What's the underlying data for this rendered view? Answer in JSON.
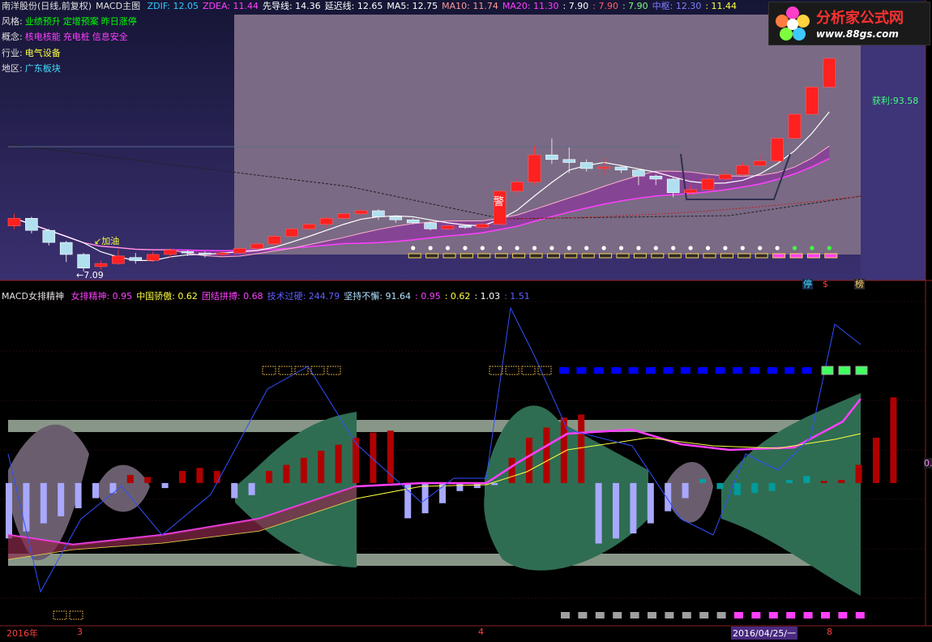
{
  "header": {
    "stock_title": "南洋股份(日线,前复权)",
    "main_chart": "MACD主图",
    "indicators": [
      {
        "label": "ZDIF: 12.05",
        "color": "#35c8ff"
      },
      {
        "label": "ZDEA: 11.44",
        "color": "#ff40ff"
      },
      {
        "label": "先导线: 14.36",
        "color": "#ffffff"
      },
      {
        "label": "延迟线: 12.65",
        "color": "#ffffff"
      },
      {
        "label": "MA5: 12.75",
        "color": "#ffffff"
      },
      {
        "label": "MA10: 11.74",
        "color": "#ff9a9a"
      },
      {
        "label": "MA20: 11.30",
        "color": "#ff40ff"
      },
      {
        "label": ": 7.90",
        "color": "#ffffff"
      },
      {
        "label": ": 7.90",
        "color": "#ff6060"
      },
      {
        "label": ": 7.90",
        "color": "#7dff7d"
      },
      {
        "label": "中枢: 12.30",
        "color": "#8080ff"
      },
      {
        "label": ": 11.44",
        "color": "#ffff40"
      }
    ]
  },
  "stock_info": [
    {
      "label": "风格:",
      "values": [
        "业绩预升",
        "定增预案",
        "昨日涨停"
      ],
      "color": "#00ff00"
    },
    {
      "label": "概念:",
      "values": [
        "核电核能",
        "充电桩",
        "信息安全"
      ],
      "color": "#ff40ff"
    },
    {
      "label": "行业:",
      "values": [
        "电气设备"
      ],
      "color": "#ffff40"
    },
    {
      "label": "地区:",
      "values": [
        "广东板块"
      ],
      "color": "#40e0ff"
    }
  ],
  "main_annotations": {
    "profit": "获利:93.58",
    "low_price": "←7.09",
    "add_oil": "↙加油",
    "alarm": "警"
  },
  "logo": {
    "name": "分析家公式网",
    "url": "www.88gs.com"
  },
  "side_buttons": [
    {
      "label": "停",
      "color": "#40e0ff"
    },
    {
      "label": "$",
      "color": "#ff4040"
    },
    {
      "label": "榜",
      "color": "#ffcc66"
    }
  ],
  "sub_header": {
    "name": "MACD女排精神",
    "indicators": [
      {
        "label": "女排精神: 0.95",
        "color": "#ff40ff"
      },
      {
        "label": "中国骄傲: 0.62",
        "color": "#ffff40"
      },
      {
        "label": "团结拼搏: 0.68",
        "color": "#ff40ff"
      },
      {
        "label": "技术过硬: 244.79",
        "color": "#6060ff"
      },
      {
        "label": "坚持不懈: 91.64",
        "color": "#b0e0ff"
      },
      {
        "label": ": 0.95",
        "color": "#ff40ff"
      },
      {
        "label": ": 0.62",
        "color": "#ffff40"
      },
      {
        "label": ": 1.03",
        "color": "#ffffff"
      },
      {
        "label": ": 1.51",
        "color": "#6060ff"
      }
    ]
  },
  "sub_value_tag": "0.",
  "x_axis": {
    "labels": [
      "2016年",
      "3",
      "4",
      "2016/04/25/一",
      "8"
    ]
  },
  "colors": {
    "up": "#ff2020",
    "down": "#00c8c8",
    "panel_bg": "#7a6a85",
    "cloud_green": "#2f6d52",
    "cloud_gray": "#6a5e6e"
  },
  "chart_data": {
    "type": "candlestick",
    "note_series": "daily candles",
    "candles": [
      {
        "o": 10.1,
        "c": 10.6,
        "h": 10.9,
        "l": 9.9
      },
      {
        "o": 10.6,
        "c": 9.8,
        "h": 10.7,
        "l": 9.6
      },
      {
        "o": 9.8,
        "c": 9.0,
        "h": 9.9,
        "l": 8.8
      },
      {
        "o": 9.0,
        "c": 8.2,
        "h": 9.1,
        "l": 7.7
      },
      {
        "o": 8.2,
        "c": 7.3,
        "h": 8.3,
        "l": 7.09
      },
      {
        "o": 7.4,
        "c": 7.6,
        "h": 7.8,
        "l": 7.2
      },
      {
        "o": 7.6,
        "c": 8.1,
        "h": 8.5,
        "l": 7.5
      },
      {
        "o": 8.0,
        "c": 7.8,
        "h": 8.3,
        "l": 7.6
      },
      {
        "o": 7.8,
        "c": 8.2,
        "h": 8.4,
        "l": 7.7
      },
      {
        "o": 8.2,
        "c": 8.5,
        "h": 8.6,
        "l": 8.0
      },
      {
        "o": 8.4,
        "c": 8.3,
        "h": 8.5,
        "l": 8.1
      },
      {
        "o": 8.3,
        "c": 8.2,
        "h": 8.4,
        "l": 8.0
      },
      {
        "o": 8.2,
        "c": 8.3,
        "h": 8.4,
        "l": 8.1
      },
      {
        "o": 8.3,
        "c": 8.6,
        "h": 8.7,
        "l": 8.2
      },
      {
        "o": 8.6,
        "c": 8.9,
        "h": 9.0,
        "l": 8.5
      },
      {
        "o": 8.9,
        "c": 9.4,
        "h": 9.5,
        "l": 8.8
      },
      {
        "o": 9.4,
        "c": 9.9,
        "h": 10.0,
        "l": 9.3
      },
      {
        "o": 9.9,
        "c": 10.2,
        "h": 10.3,
        "l": 9.8
      },
      {
        "o": 10.2,
        "c": 10.6,
        "h": 10.7,
        "l": 10.0
      },
      {
        "o": 10.6,
        "c": 10.9,
        "h": 11.0,
        "l": 10.5
      },
      {
        "o": 10.9,
        "c": 11.1,
        "h": 11.2,
        "l": 10.8
      },
      {
        "o": 11.1,
        "c": 10.7,
        "h": 11.2,
        "l": 10.5
      },
      {
        "o": 10.7,
        "c": 10.5,
        "h": 10.8,
        "l": 10.3
      },
      {
        "o": 10.5,
        "c": 10.3,
        "h": 10.6,
        "l": 10.2
      },
      {
        "o": 10.3,
        "c": 9.9,
        "h": 10.4,
        "l": 9.8
      },
      {
        "o": 9.9,
        "c": 10.1,
        "h": 10.2,
        "l": 9.8
      },
      {
        "o": 10.1,
        "c": 10.0,
        "h": 10.2,
        "l": 9.9
      },
      {
        "o": 10.0,
        "c": 10.2,
        "h": 10.3,
        "l": 9.9
      },
      {
        "o": 10.2,
        "c": 12.4,
        "h": 12.5,
        "l": 10.1
      },
      {
        "o": 12.4,
        "c": 13.0,
        "h": 13.3,
        "l": 12.1
      },
      {
        "o": 13.0,
        "c": 14.8,
        "h": 15.4,
        "l": 12.8
      },
      {
        "o": 14.8,
        "c": 14.5,
        "h": 15.9,
        "l": 14.2
      },
      {
        "o": 14.5,
        "c": 14.3,
        "h": 15.3,
        "l": 13.6
      },
      {
        "o": 14.3,
        "c": 13.9,
        "h": 14.5,
        "l": 13.7
      },
      {
        "o": 13.9,
        "c": 14.0,
        "h": 14.6,
        "l": 13.5
      },
      {
        "o": 14.0,
        "c": 13.8,
        "h": 14.1,
        "l": 13.6
      },
      {
        "o": 13.8,
        "c": 13.4,
        "h": 13.9,
        "l": 12.8
      },
      {
        "o": 13.4,
        "c": 13.2,
        "h": 13.5,
        "l": 12.8
      },
      {
        "o": 13.2,
        "c": 12.3,
        "h": 13.3,
        "l": 12.0
      },
      {
        "o": 12.3,
        "c": 12.5,
        "h": 12.8,
        "l": 12.1
      },
      {
        "o": 12.5,
        "c": 13.2,
        "h": 13.4,
        "l": 12.4
      },
      {
        "o": 13.2,
        "c": 13.5,
        "h": 13.8,
        "l": 13.1
      },
      {
        "o": 13.5,
        "c": 14.1,
        "h": 14.3,
        "l": 13.4
      },
      {
        "o": 14.1,
        "c": 14.4,
        "h": 14.8,
        "l": 14.0
      },
      {
        "o": 14.4,
        "c": 15.9,
        "h": 16.0,
        "l": 14.3
      },
      {
        "o": 15.9,
        "c": 17.5,
        "h": 17.5,
        "l": 15.9
      },
      {
        "o": 17.5,
        "c": 19.3,
        "h": 19.3,
        "l": 17.5
      },
      {
        "o": 19.3,
        "c": 21.2,
        "h": 21.2,
        "l": 19.3
      }
    ],
    "macd_hist": [
      -0.55,
      -0.48,
      -0.4,
      -0.33,
      -0.25,
      -0.15,
      -0.1,
      0.08,
      0.06,
      -0.05,
      0.12,
      0.15,
      0.12,
      -0.15,
      -0.12,
      0.12,
      0.18,
      0.25,
      0.32,
      0.38,
      0.45,
      0.5,
      0.52,
      -0.35,
      -0.3,
      -0.2,
      -0.08,
      -0.05,
      -0.02,
      0.25,
      0.45,
      0.55,
      0.65,
      0.68,
      -0.6,
      -0.55,
      -0.5,
      -0.4,
      -0.28,
      -0.15,
      0.04,
      -0.06,
      -0.12,
      -0.1,
      -0.08,
      0.03,
      0.07,
      0.02,
      0.03,
      0.18,
      0.45,
      0.85
    ],
    "ylim_main": [
      6.8,
      24.0
    ],
    "ylim_sub": [
      -1.4,
      1.8
    ]
  }
}
